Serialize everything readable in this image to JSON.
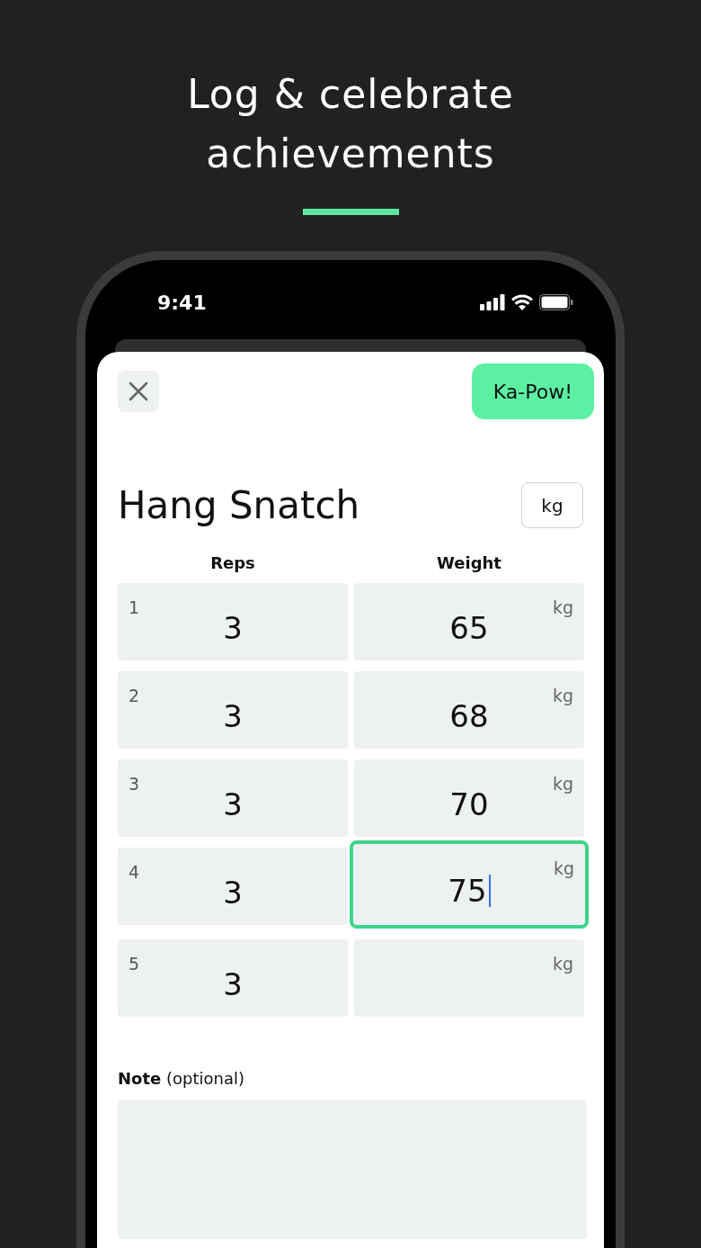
{
  "headline": "Log & celebrate achievements",
  "status_bar": {
    "time": "9:41"
  },
  "header": {
    "submit_button": "Ka-Pow!"
  },
  "exercise": {
    "title": "Hang Snatch",
    "unit_button": "kg"
  },
  "table": {
    "columns": [
      "Reps",
      "Weight"
    ],
    "rows": [
      {
        "number": "1",
        "reps": "3",
        "weight": "65",
        "unit": "kg",
        "selected": false
      },
      {
        "number": "2",
        "reps": "3",
        "weight": "68",
        "unit": "kg",
        "selected": false
      },
      {
        "number": "3",
        "reps": "3",
        "weight": "70",
        "unit": "kg",
        "selected": false
      },
      {
        "number": "4",
        "reps": "3",
        "weight": "75",
        "unit": "kg",
        "selected": true
      },
      {
        "number": "5",
        "reps": "3",
        "unit": "kg",
        "selected": false
      }
    ]
  },
  "note": {
    "label": "Note",
    "hint": "(optional)"
  }
}
